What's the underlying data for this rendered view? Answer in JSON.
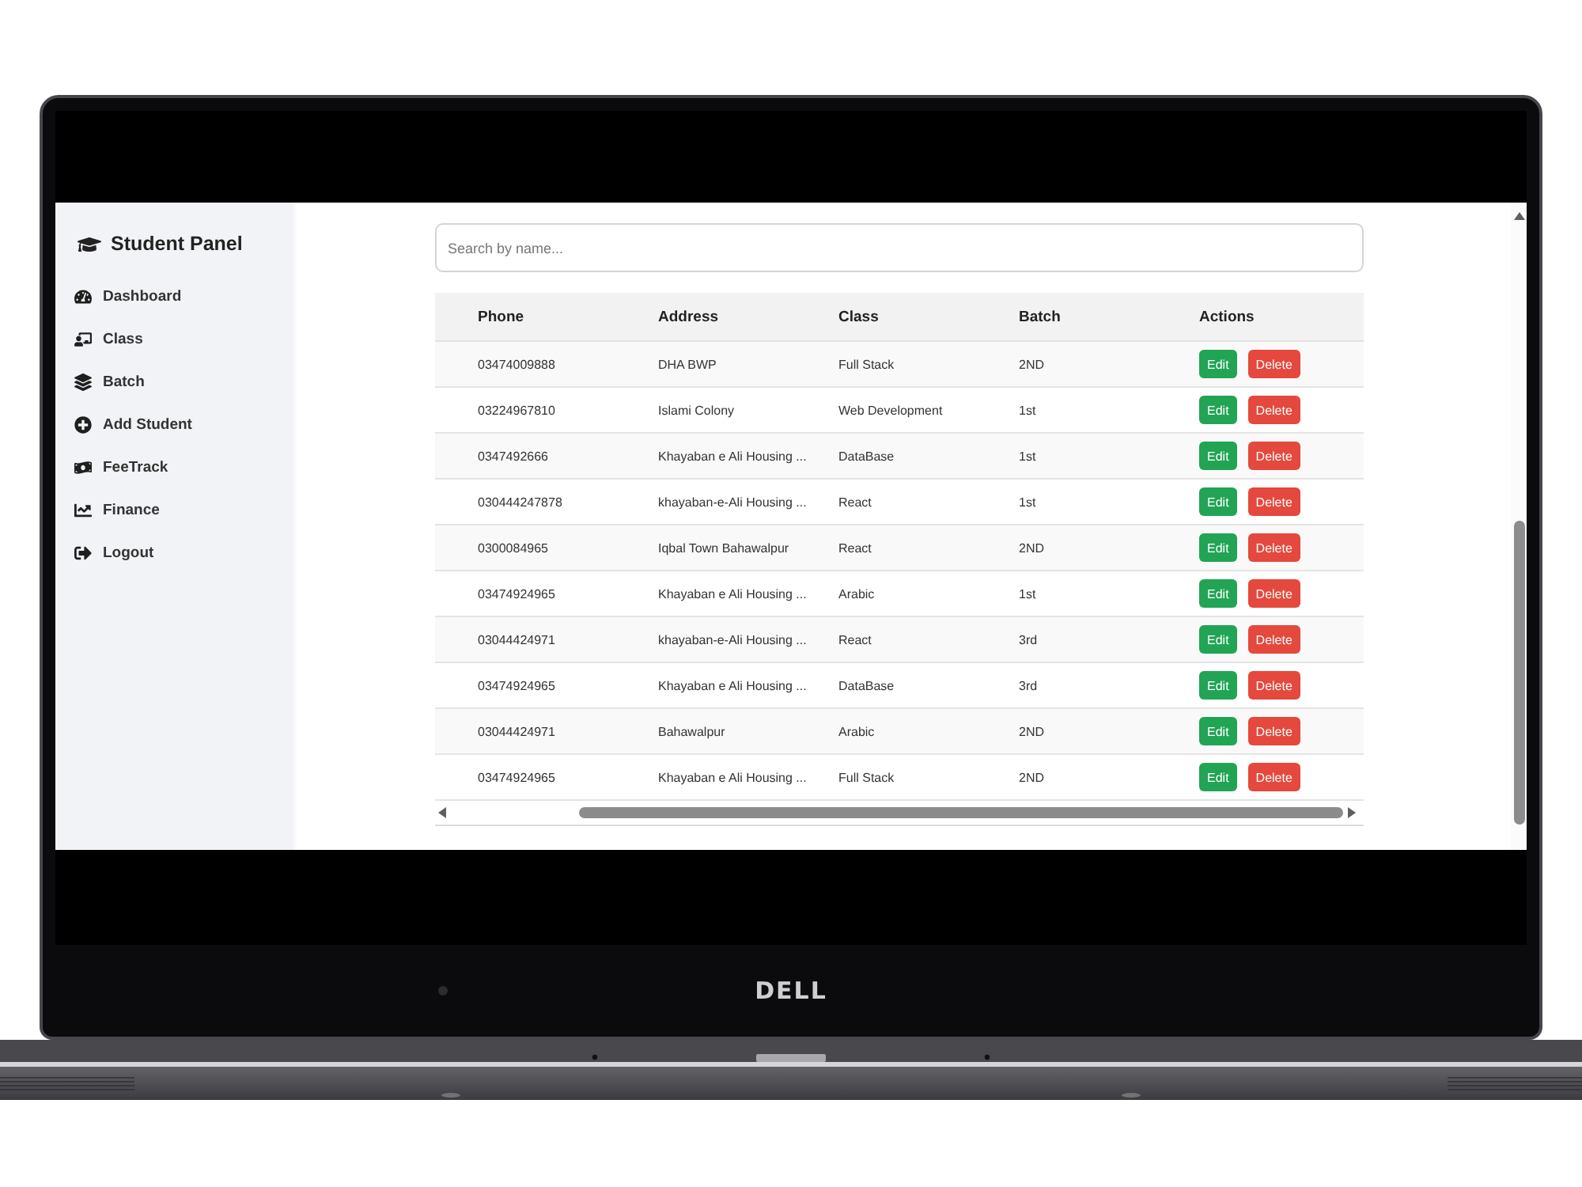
{
  "sidebar": {
    "title": "Student Panel",
    "items": [
      {
        "label": "Dashboard",
        "selected": false
      },
      {
        "label": "Class",
        "selected": false
      },
      {
        "label": "Batch",
        "selected": false
      },
      {
        "label": "Add Student",
        "selected": false
      },
      {
        "label": "FeeTrack",
        "selected": false
      },
      {
        "label": "Finance",
        "selected": false
      },
      {
        "label": "Logout",
        "selected": false
      }
    ]
  },
  "search": {
    "placeholder": "Search by name..."
  },
  "table": {
    "columns": [
      "Phone",
      "Address",
      "Class",
      "Batch",
      "Actions"
    ],
    "rows": [
      {
        "cells": [
          "03474009888",
          "DHA BWP",
          "Full Stack",
          "2ND"
        ],
        "actions": [
          {
            "label": "Edit",
            "kind": "edit"
          },
          {
            "label": "Delete",
            "kind": "delete"
          }
        ]
      },
      {
        "cells": [
          "03224967810",
          "Islami Colony",
          "Web Development",
          "1st"
        ],
        "actions": [
          {
            "label": "Edit",
            "kind": "edit"
          },
          {
            "label": "Delete",
            "kind": "delete"
          }
        ]
      },
      {
        "cells": [
          "0347492666",
          "Khayaban e Ali Housing ...",
          "DataBase",
          "1st"
        ],
        "actions": [
          {
            "label": "Edit",
            "kind": "edit"
          },
          {
            "label": "Delete",
            "kind": "delete"
          }
        ]
      },
      {
        "cells": [
          "030444247878",
          "khayaban-e-Ali Housing ...",
          "React",
          "1st"
        ],
        "actions": [
          {
            "label": "Edit",
            "kind": "edit"
          },
          {
            "label": "Delete",
            "kind": "delete"
          }
        ]
      },
      {
        "cells": [
          "0300084965",
          "Iqbal Town Bahawalpur",
          "React",
          "2ND"
        ],
        "actions": [
          {
            "label": "Edit",
            "kind": "edit"
          },
          {
            "label": "Delete",
            "kind": "delete"
          }
        ]
      },
      {
        "cells": [
          "03474924965",
          "Khayaban e Ali Housing ...",
          "Arabic",
          "1st"
        ],
        "actions": [
          {
            "label": "Edit",
            "kind": "edit"
          },
          {
            "label": "Delete",
            "kind": "delete"
          }
        ]
      },
      {
        "cells": [
          "03044424971",
          "khayaban-e-Ali Housing ...",
          "React",
          "3rd"
        ],
        "actions": [
          {
            "label": "Edit",
            "kind": "edit"
          },
          {
            "label": "Delete",
            "kind": "delete"
          }
        ]
      },
      {
        "cells": [
          "03474924965",
          "Khayaban e Ali Housing ...",
          "DataBase",
          "3rd"
        ],
        "actions": [
          {
            "label": "Edit",
            "kind": "edit"
          },
          {
            "label": "Delete",
            "kind": "delete"
          }
        ]
      },
      {
        "cells": [
          "03044424971",
          "Bahawalpur",
          "Arabic",
          "2ND"
        ],
        "actions": [
          {
            "label": "Edit",
            "kind": "edit"
          },
          {
            "label": "Delete",
            "kind": "delete"
          }
        ]
      },
      {
        "cells": [
          "03474924965",
          "Khayaban e Ali Housing ...",
          "Full Stack",
          "2ND"
        ],
        "actions": [
          {
            "label": "Edit",
            "kind": "edit"
          },
          {
            "label": "Delete",
            "kind": "delete"
          }
        ]
      }
    ]
  },
  "laptop": {
    "logo": "DELL"
  }
}
